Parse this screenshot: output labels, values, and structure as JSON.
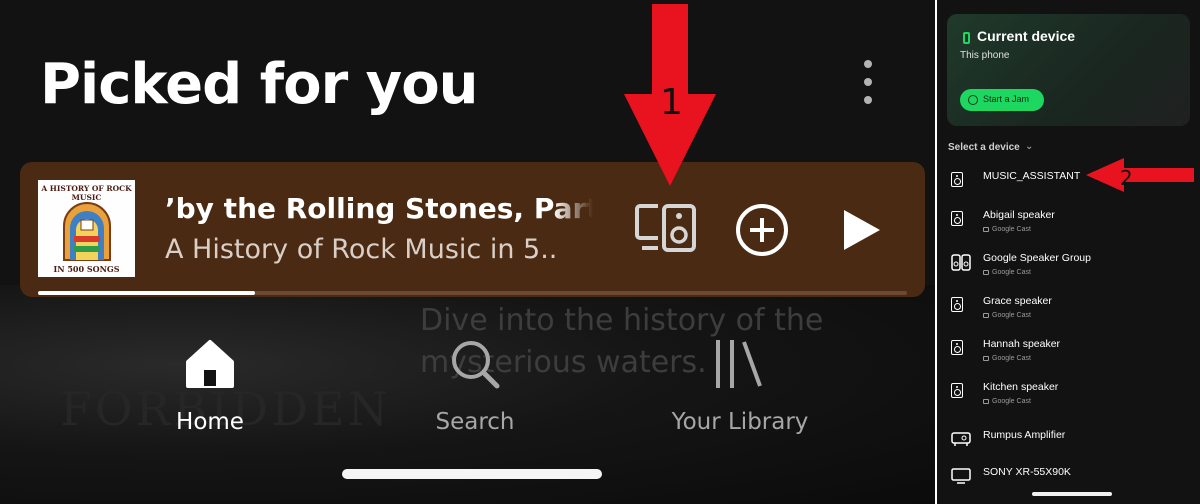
{
  "main": {
    "section_title": "Picked for you",
    "now_playing": {
      "title": "’by the Rolling Stones, Part O",
      "subtitle": "A History of Rock Music in 5..",
      "cover_top": "A HISTORY OF ROCK MUSIC",
      "cover_bottom": "IN 500 SONGS",
      "progress": 0.25
    },
    "background_description": "Dive into the history of the mysterious waters.",
    "background_word": "FORBIDDEN",
    "nav": {
      "home": "Home",
      "search": "Search",
      "library": "Your Library"
    }
  },
  "annotations": {
    "arrow1_label": "1",
    "arrow2_label": "2",
    "arrow_color": "#e8131f"
  },
  "device_picker": {
    "current_title": "Current device",
    "current_subtitle": "This phone",
    "jam_label": "Start a Jam",
    "select_label": "Select a device",
    "devices": [
      {
        "name": "MUSIC_ASSISTANT",
        "sub": ""
      },
      {
        "name": "Abigail speaker",
        "sub": "Google Cast"
      },
      {
        "name": "Google Speaker Group",
        "sub": "Google Cast"
      },
      {
        "name": "Grace speaker",
        "sub": "Google Cast"
      },
      {
        "name": "Hannah speaker",
        "sub": "Google Cast"
      },
      {
        "name": "Kitchen speaker",
        "sub": "Google Cast"
      },
      {
        "name": "Rumpus Amplifier",
        "sub": ""
      },
      {
        "name": "SONY XR-55X90K",
        "sub": ""
      }
    ]
  },
  "colors": {
    "accent_green": "#1ed760",
    "player_bg": "#4a2a12"
  }
}
